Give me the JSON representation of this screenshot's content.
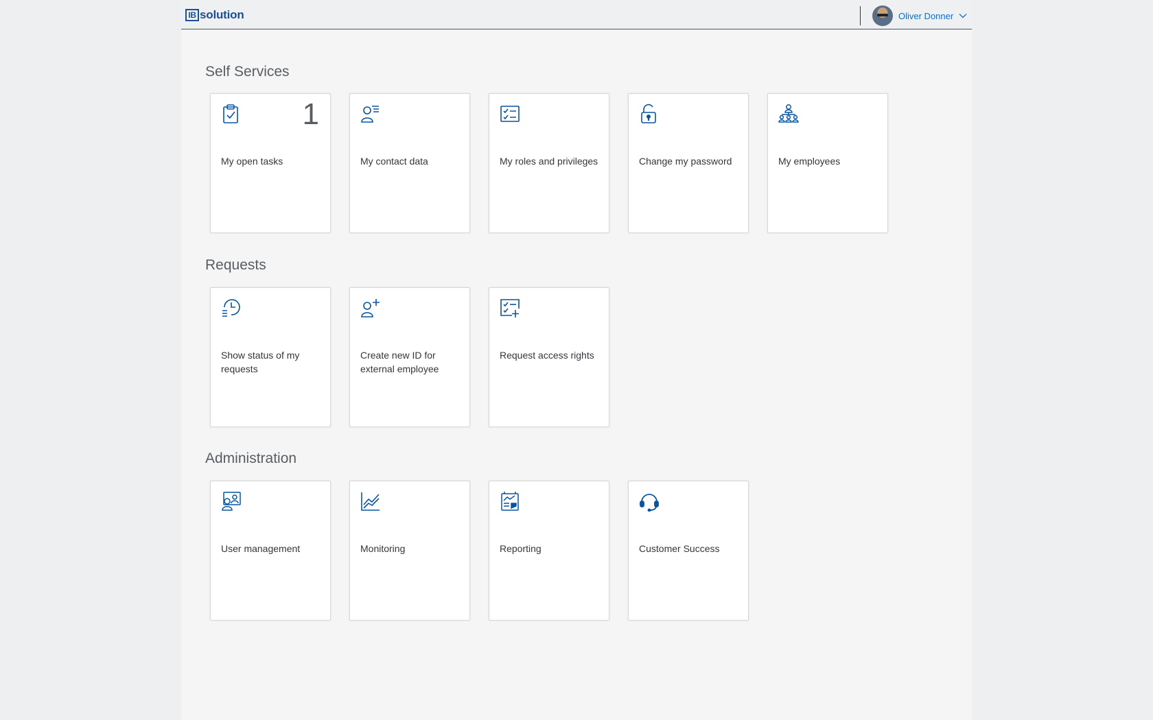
{
  "header": {
    "logo_box": "IB",
    "logo_text": "solution",
    "user_name": "Oliver Donner"
  },
  "colors": {
    "accent": "#0a6ed1",
    "icon": "#0854a0",
    "logo": "#1b4f94"
  },
  "sections": [
    {
      "title": "Self Services",
      "tiles": [
        {
          "label": "My open tasks",
          "icon": "clipboard-check-icon",
          "count": "1"
        },
        {
          "label": "My contact data",
          "icon": "person-list-icon"
        },
        {
          "label": "My roles and privileges",
          "icon": "checklist-icon"
        },
        {
          "label": "Change my password",
          "icon": "unlocked-icon"
        },
        {
          "label": "My employees",
          "icon": "org-chart-icon"
        }
      ]
    },
    {
      "title": "Requests",
      "tiles": [
        {
          "label": "Show status of my requests",
          "icon": "history-list-icon"
        },
        {
          "label": "Create new ID for external employee",
          "icon": "add-person-icon"
        },
        {
          "label": "Request access rights",
          "icon": "checklist-add-icon"
        }
      ]
    },
    {
      "title": "Administration",
      "tiles": [
        {
          "label": "User management",
          "icon": "user-management-icon"
        },
        {
          "label": "Monitoring",
          "icon": "line-chart-icon"
        },
        {
          "label": "Reporting",
          "icon": "report-icon"
        },
        {
          "label": "Customer Success",
          "icon": "headset-icon"
        }
      ]
    }
  ]
}
